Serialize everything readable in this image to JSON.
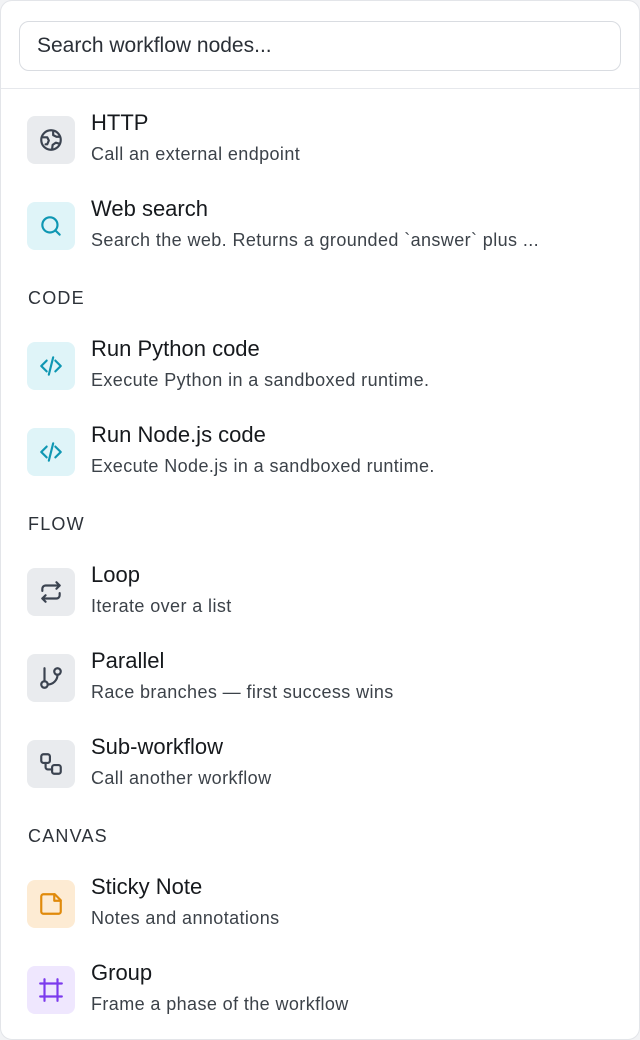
{
  "search": {
    "placeholder": "Search workflow nodes..."
  },
  "sections": [
    {
      "label": "",
      "items": [
        {
          "title": "HTTP",
          "description": "Call an external endpoint",
          "icon": "globe-icon",
          "icon_color": "#3b4350",
          "icon_bg": "#e9ebee"
        },
        {
          "title": "Web search",
          "description": "Search the web. Returns a grounded `answer` plus ...",
          "icon": "search-icon",
          "icon_color": "#0f97b3",
          "icon_bg": "#dff4f8"
        }
      ]
    },
    {
      "label": "CODE",
      "items": [
        {
          "title": "Run Python code",
          "description": "Execute Python in a sandboxed runtime.",
          "icon": "code-icon",
          "icon_color": "#0f97b3",
          "icon_bg": "#dff4f8"
        },
        {
          "title": "Run Node.js code",
          "description": "Execute Node.js in a sandboxed runtime.",
          "icon": "code-icon",
          "icon_color": "#0f97b3",
          "icon_bg": "#dff4f8"
        }
      ]
    },
    {
      "label": "FLOW",
      "items": [
        {
          "title": "Loop",
          "description": "Iterate over a list",
          "icon": "repeat-icon",
          "icon_color": "#3b4350",
          "icon_bg": "#e9ebee"
        },
        {
          "title": "Parallel",
          "description": "Race branches — first success wins",
          "icon": "git-branch-icon",
          "icon_color": "#3b4350",
          "icon_bg": "#e9ebee"
        },
        {
          "title": "Sub-workflow",
          "description": "Call another workflow",
          "icon": "workflow-icon",
          "icon_color": "#3b4350",
          "icon_bg": "#e9ebee"
        }
      ]
    },
    {
      "label": "CANVAS",
      "items": [
        {
          "title": "Sticky Note",
          "description": "Notes and annotations",
          "icon": "sticky-note-icon",
          "icon_color": "#e08a0b",
          "icon_bg": "#fdebd3"
        },
        {
          "title": "Group",
          "description": "Frame a phase of the workflow",
          "icon": "frame-icon",
          "icon_color": "#7c3aed",
          "icon_bg": "#efe7fe"
        }
      ]
    }
  ]
}
